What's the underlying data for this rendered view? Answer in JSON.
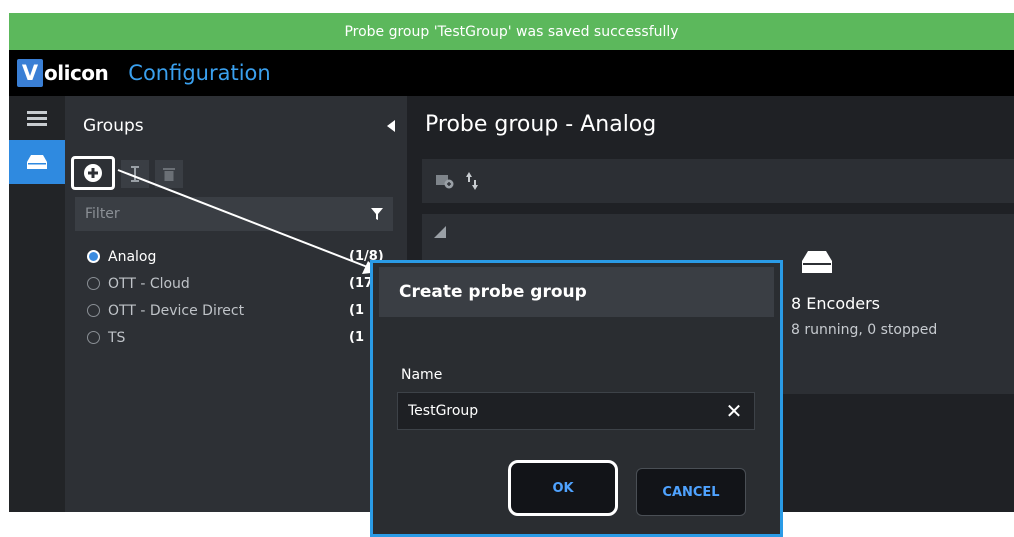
{
  "toast": {
    "message": "Probe group 'TestGroup' was saved successfully"
  },
  "header": {
    "logo_first": "V",
    "logo_rest": "olicon",
    "app_title": "Configuration"
  },
  "groups_panel": {
    "title": "Groups",
    "filter_placeholder": "Filter",
    "items": [
      {
        "name": "Analog",
        "count": "(1/8)",
        "selected": true
      },
      {
        "name": "OTT - Cloud",
        "count": "(17",
        "selected": false
      },
      {
        "name": "OTT - Device Direct",
        "count": "(1",
        "selected": false
      },
      {
        "name": "TS",
        "count": "(1",
        "selected": false
      }
    ]
  },
  "main": {
    "title": "Probe group - Analog",
    "encoders": {
      "count_label": "8 Encoders",
      "status": "8 running, 0 stopped"
    }
  },
  "dialog": {
    "title": "Create probe group",
    "name_label": "Name",
    "name_value": "TestGroup",
    "ok_label": "OK",
    "cancel_label": "CANCEL"
  },
  "colors": {
    "accent": "#2a9be6",
    "success": "#5cb85c",
    "brand": "#3a7fd5"
  }
}
